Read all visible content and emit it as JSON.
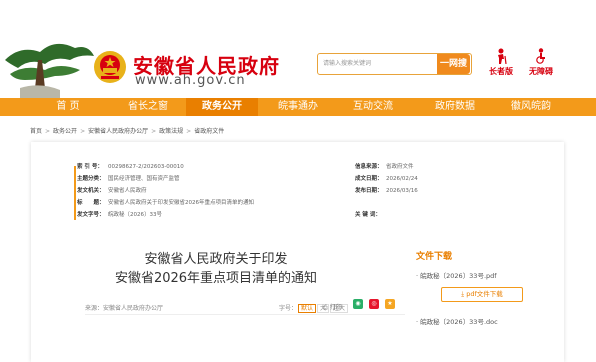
{
  "header": {
    "site_title": "安徽省人民政府",
    "site_url": "www.ah.gov.cn",
    "search_placeholder": "请输入搜索关键词",
    "search_button": "一网搜",
    "tools": [
      {
        "label": "长者版",
        "icon": "elder-icon"
      },
      {
        "label": "无障碍",
        "icon": "accessibility-icon"
      }
    ]
  },
  "nav": {
    "items": [
      {
        "label": "首 页"
      },
      {
        "label": "省长之窗"
      },
      {
        "label": "政务公开",
        "active": true
      },
      {
        "label": "皖事通办"
      },
      {
        "label": "互动交流"
      },
      {
        "label": "政府数据"
      },
      {
        "label": "徽风皖韵"
      }
    ]
  },
  "breadcrumb": [
    "首页",
    "政务公开",
    "安徽省人民政府办公厅",
    "政策法规",
    "省政府文件"
  ],
  "meta": {
    "index_no_label": "索 引 号：",
    "index_no": "00298627-2/202603-00010",
    "topic_label": "主题分类：",
    "topic": "国民经济管理、国有资产监管",
    "issuer_label": "发文机关：",
    "issuer": "安徽省人民政府",
    "name_label": "标　　题：",
    "name": "安徽省人民政府关于印发安徽省2026年重点项目清单的通知",
    "doc_no_label": "发文字号：",
    "doc_no": "皖政秘〔2026〕33号",
    "info_source_label": "信息来源：",
    "info_source": "省政府文件",
    "created_label": "成文日期：",
    "created": "2026/02/24",
    "published_label": "发布日期：",
    "published": "2026/03/16",
    "keywords_label": "关 键 词："
  },
  "doc": {
    "title_line1": "安徽省人民政府关于印发",
    "title_line2": "安徽省2026年重点项目清单的通知",
    "source": "来源：安徽省人民政府办公厅",
    "fontsize_label": "字号：",
    "fontsize_options": [
      "默认",
      "大",
      "超大"
    ],
    "print": "打印"
  },
  "download": {
    "title": "文件下载",
    "file1": "· 皖政秘〔2026〕33号.pdf",
    "button": "pdf文件下载",
    "file2": "· 皖政秘〔2026〕33号.doc"
  },
  "colors": {
    "brand_red": "#d7000f",
    "nav_orange": "#f39a1a",
    "nav_active": "#e97f00"
  }
}
